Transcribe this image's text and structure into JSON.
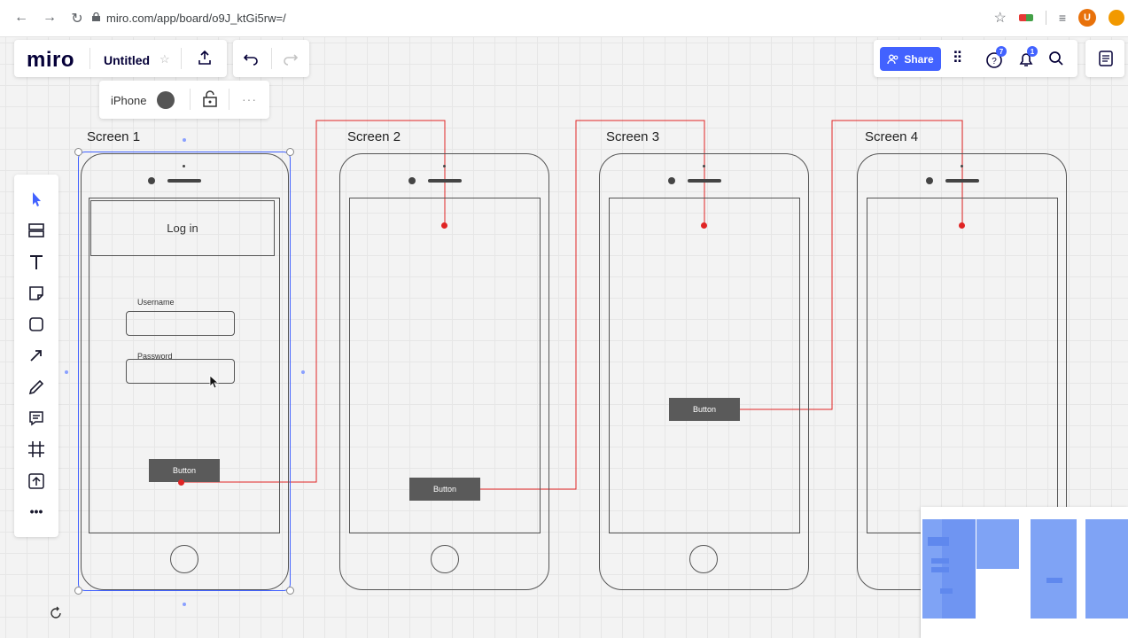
{
  "browser": {
    "url": "miro.com/app/board/o9J_ktGi5rw=/",
    "avatar_letter": "U"
  },
  "miro": {
    "logo": "miro",
    "board_title": "Untitled",
    "share_label": "Share",
    "help_badge": "7",
    "notif_badge": "1"
  },
  "context_toolbar": {
    "label": "iPhone",
    "more": "···"
  },
  "screens": [
    {
      "label": "Screen 1"
    },
    {
      "label": "Screen 2"
    },
    {
      "label": "Screen 3"
    },
    {
      "label": "Screen 4"
    }
  ],
  "screen1": {
    "login_title": "Log in",
    "username_label": "Username",
    "password_label": "Password",
    "button_label": "Button"
  },
  "screen2": {
    "button_label": "Button"
  },
  "screen3": {
    "button_label": "Button"
  },
  "colors": {
    "accent": "#4262ff",
    "connector": "#e02424"
  }
}
